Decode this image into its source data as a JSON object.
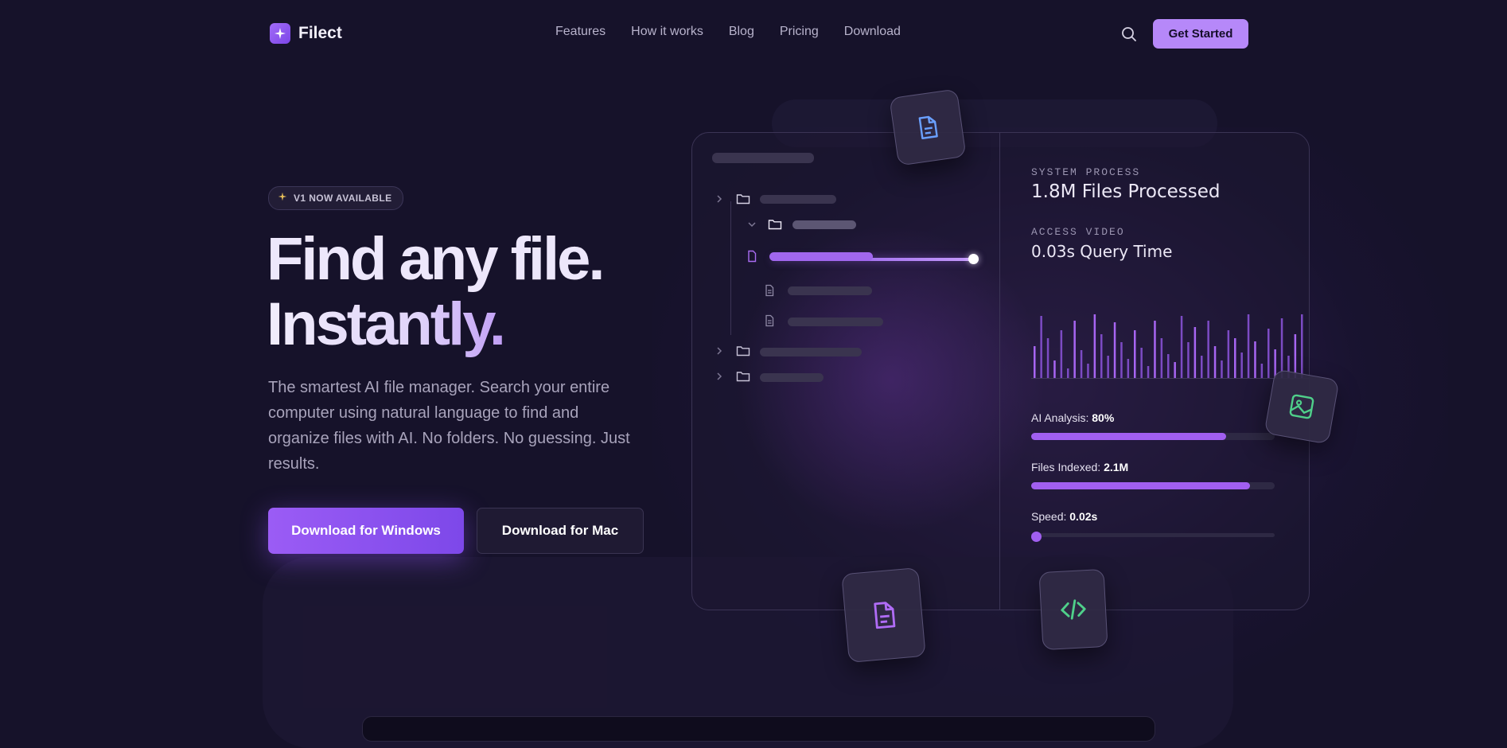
{
  "header": {
    "logo_text": "Filect",
    "nav": [
      "Features",
      "How it works",
      "Blog",
      "Pricing",
      "Download"
    ],
    "cta_label": "Get Started"
  },
  "hero": {
    "badge": "V1 NOW AVAILABLE",
    "headline_line1": "Find any file.",
    "headline_line2": "Instantly.",
    "description": "The smartest AI file manager. Search your entire computer using natural language to find and organize files with AI. No folders. No guessing. Just results.",
    "download_windows": "Download for Windows",
    "download_mac": "Download for Mac"
  },
  "panel": {
    "system_label": "SYSTEM PROCESS",
    "system_value": "1.8M Files Processed",
    "access_label": "ACCESS VIDEO",
    "access_value": "0.03s Query Time",
    "metrics": [
      {
        "label": "AI Analysis:",
        "value": "80%",
        "progress": 0.8
      },
      {
        "label": "Files Indexed:",
        "value": "2.1M",
        "progress": 0.9
      },
      {
        "label": "Speed:",
        "value": "0.02s",
        "progress": 0.0
      }
    ]
  },
  "colors": {
    "accent": "#a15ff0",
    "cta": "#b688f9",
    "background": "#16122a",
    "green_icon": "#4fd08a",
    "blue_icon": "#6aa0ff"
  },
  "icons": [
    "sparkle-icon",
    "search-icon",
    "folder-icon",
    "chevron-right-icon",
    "chevron-down-icon",
    "file-icon",
    "document-icon",
    "image-icon",
    "code-icon"
  ]
}
